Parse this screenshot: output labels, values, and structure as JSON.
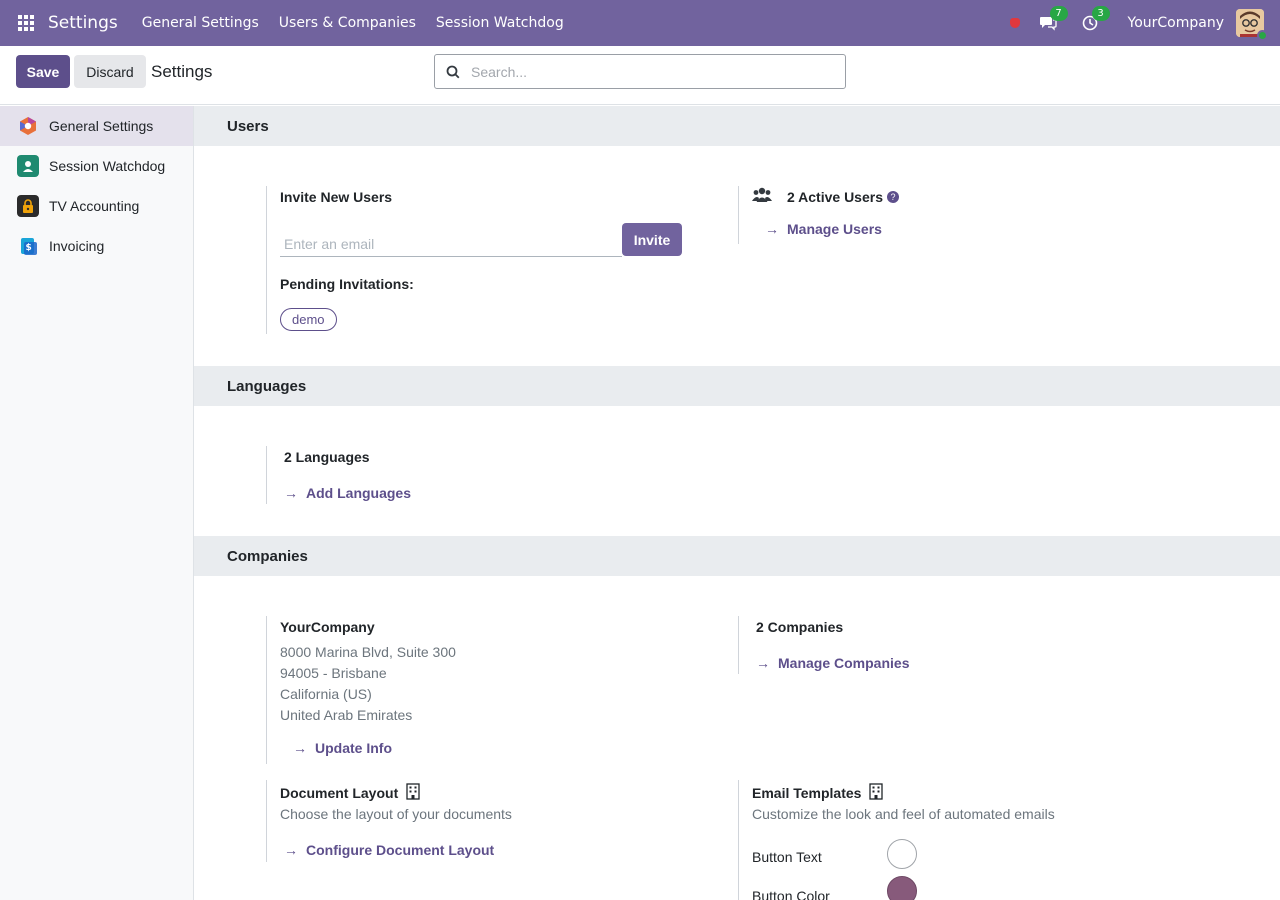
{
  "navbar": {
    "brand": "Settings",
    "menu": [
      "General Settings",
      "Users & Companies",
      "Session Watchdog"
    ],
    "messages_count": "7",
    "activities_count": "3",
    "company": "YourCompany"
  },
  "control_panel": {
    "save_label": "Save",
    "discard_label": "Discard",
    "title": "Settings",
    "search_placeholder": "Search..."
  },
  "sidebar": {
    "items": [
      {
        "label": "General Settings",
        "icon": "general-settings-icon",
        "color": "#e8703a"
      },
      {
        "label": "Session Watchdog",
        "icon": "session-watchdog-icon",
        "color": "#1f8a70"
      },
      {
        "label": "TV Accounting",
        "icon": "tv-accounting-icon",
        "color": "#f0a30a"
      },
      {
        "label": "Invoicing",
        "icon": "invoicing-icon",
        "color": "#1aa5d8"
      }
    ]
  },
  "users": {
    "title": "Users",
    "invite_label": "Invite New Users",
    "email_placeholder": "Enter an email",
    "invite_button": "Invite",
    "pending_label": "Pending Invitations:",
    "pending": [
      "demo"
    ],
    "active_users": "2 Active Users",
    "manage_users": "Manage Users"
  },
  "languages": {
    "title": "Languages",
    "count": "2 Languages",
    "add": "Add Languages"
  },
  "companies": {
    "title": "Companies",
    "company_name": "YourCompany",
    "address": [
      "8000 Marina Blvd, Suite 300",
      "94005 - Brisbane",
      "California (US)",
      "United Arab Emirates"
    ],
    "update_info": "Update Info",
    "count": "2 Companies",
    "manage": "Manage Companies",
    "doc_layout_title": "Document Layout",
    "doc_layout_desc": "Choose the layout of your documents",
    "doc_layout_link": "Configure Document Layout",
    "email_templates_title": "Email Templates",
    "email_templates_desc": "Customize the look and feel of automated emails",
    "button_text_label": "Button Text",
    "button_color_label": "Button Color",
    "button_text_color": "#ffffff",
    "button_color": "#875a7b"
  },
  "colors": {
    "navbar": "#71639e",
    "primary": "#5d4f8b",
    "badge": "#28a745"
  }
}
